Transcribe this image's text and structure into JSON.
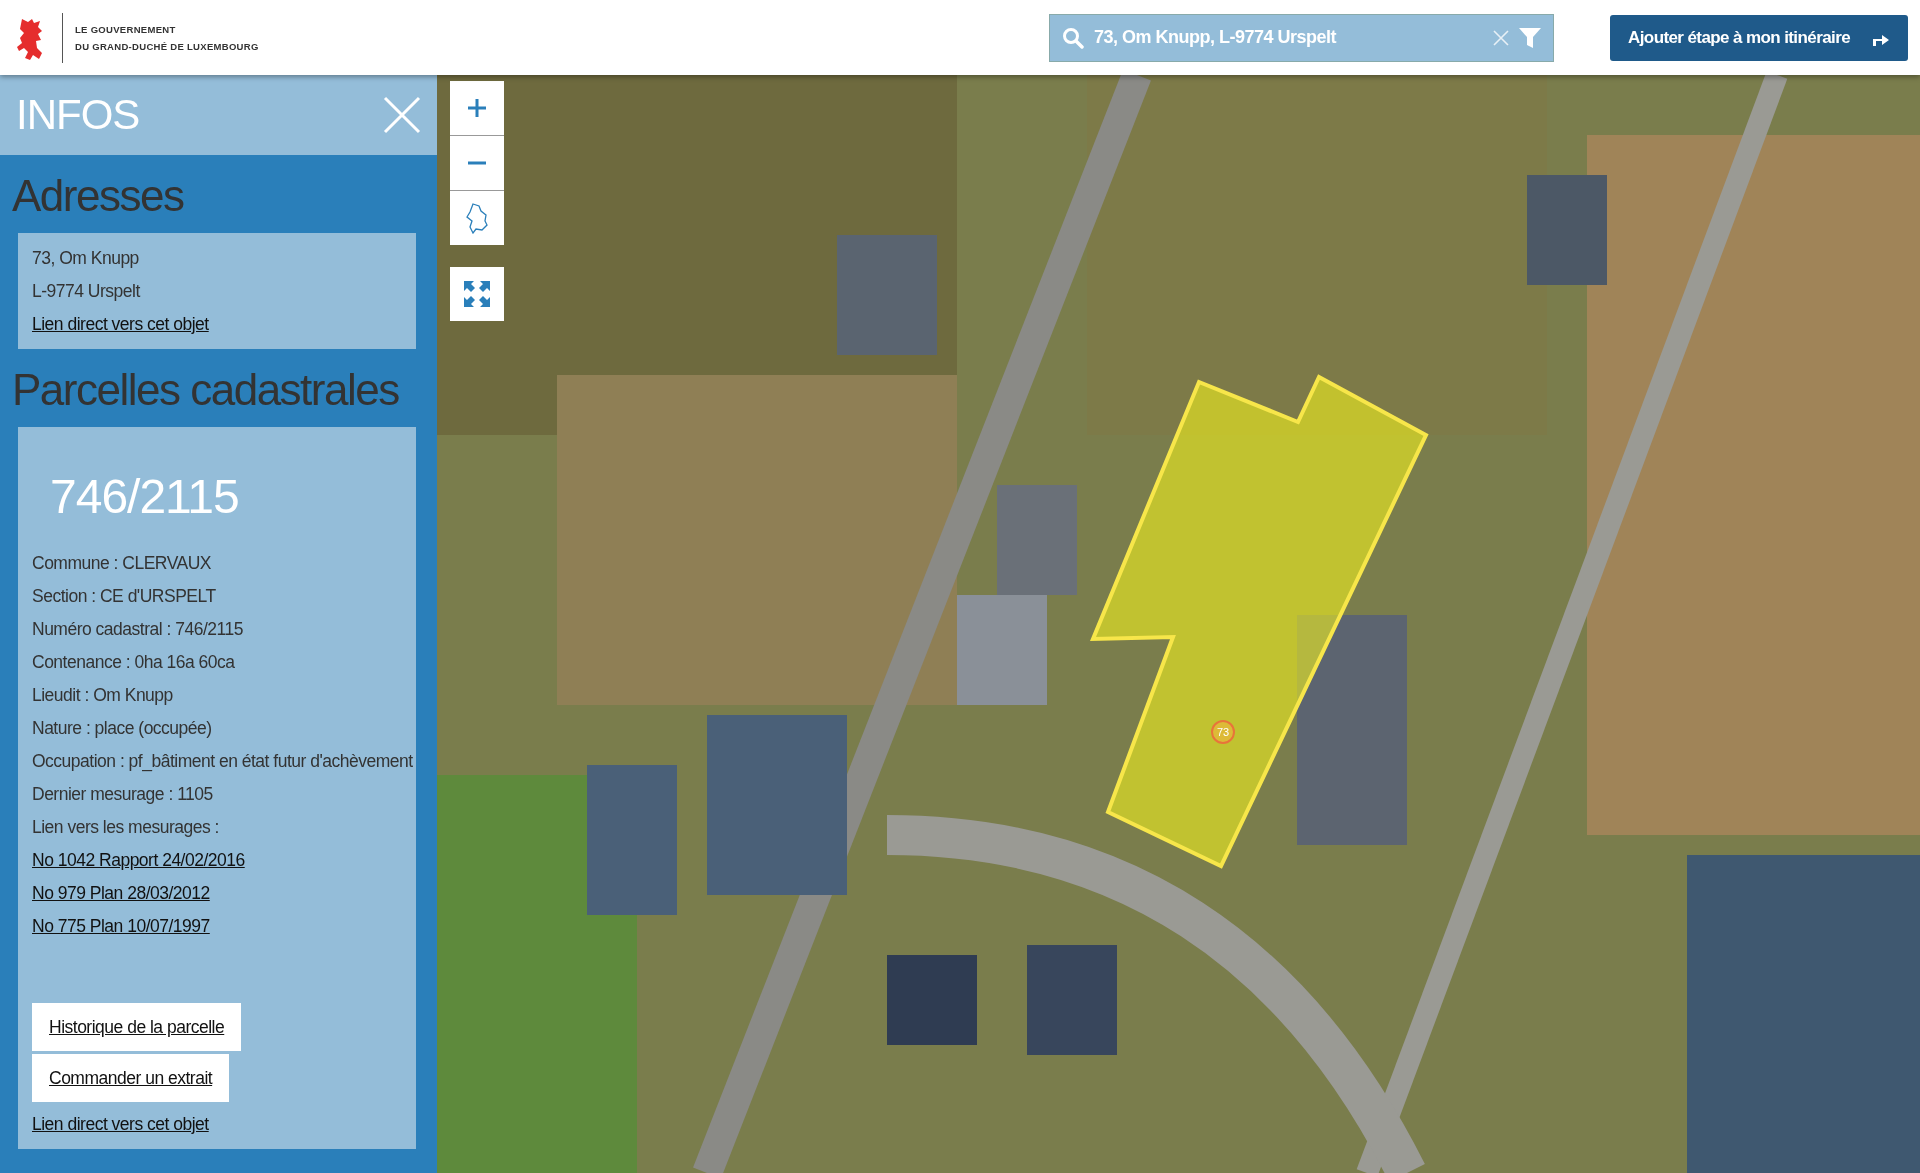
{
  "header": {
    "logo_lines": [
      "LE GOUVERNEMENT",
      "DU GRAND-DUCHÉ DE LUXEMBOURG"
    ]
  },
  "search": {
    "value": "73, Om Knupp, L-9774 Urspelt"
  },
  "route_button": {
    "label": "Ajouter étape à mon itinéraire"
  },
  "panel": {
    "title": "INFOS"
  },
  "addresses": {
    "heading": "Adresses",
    "lines": [
      "73, Om Knupp",
      "L-9774 Urspelt"
    ],
    "link": "Lien direct vers cet objet"
  },
  "parcels": {
    "heading": "Parcelles cadastrales",
    "number": "746/2115",
    "details": [
      "Commune : CLERVAUX",
      "Section : CE d'URSPELT",
      "Numéro cadastral : 746/2115",
      "Contenance : 0ha 16a 60ca",
      "Lieudit : Om Knupp",
      "Nature : place (occupée)",
      "Occupation : pf_bâtiment en état futur d'achèvement",
      "Dernier mesurage : 1105",
      "Lien vers les mesurages :"
    ],
    "mesurages": [
      "No 1042 Rapport 24/02/2016",
      "No 979 Plan 28/03/2012",
      "No 775 Plan 10/07/1997"
    ],
    "buttons": [
      "Historique de la parcelle",
      "Commander un extrait"
    ],
    "link": "Lien direct vers cet objet"
  },
  "map": {
    "marker_label": "73"
  }
}
